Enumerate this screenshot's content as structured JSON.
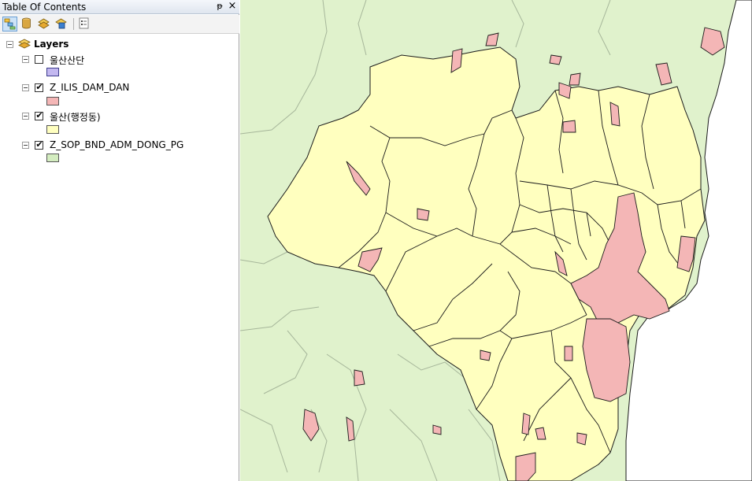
{
  "toc": {
    "title": "Table Of Contents",
    "pin_glyph": "ᵽ",
    "close_glyph": "×",
    "toolbar": [
      {
        "name": "list-by-drawing-order-icon",
        "active": true
      },
      {
        "name": "list-by-source-icon",
        "active": false
      },
      {
        "name": "list-by-visibility-icon",
        "active": false
      },
      {
        "name": "list-by-selection-icon",
        "active": false
      },
      {
        "name": "options-icon",
        "active": false
      }
    ],
    "root_label": "Layers",
    "layers": [
      {
        "label": "울산산단",
        "checked": false,
        "fill": "#c3b8f0",
        "stroke": "#3c3c8c"
      },
      {
        "label": "Z_ILIS_DAM_DAN",
        "checked": true,
        "fill": "#f4b6b6",
        "stroke": "#555555"
      },
      {
        "label": "울산(행정동)",
        "checked": true,
        "fill": "#ffffbf",
        "stroke": "#555555"
      },
      {
        "label": "Z_SOP_BND_ADM_DONG_PG",
        "checked": true,
        "fill": "#d4edc0",
        "stroke": "#555555"
      }
    ]
  },
  "map": {
    "colors": {
      "background_admin": "#e0f2cc",
      "admin_border": "#a6b69a",
      "ulsan_district": "#ffffbf",
      "district_border": "#1a1a1a",
      "dam": "#f4b6b6",
      "dam_border": "#1a1a1a",
      "sea": "#ffffff"
    }
  }
}
